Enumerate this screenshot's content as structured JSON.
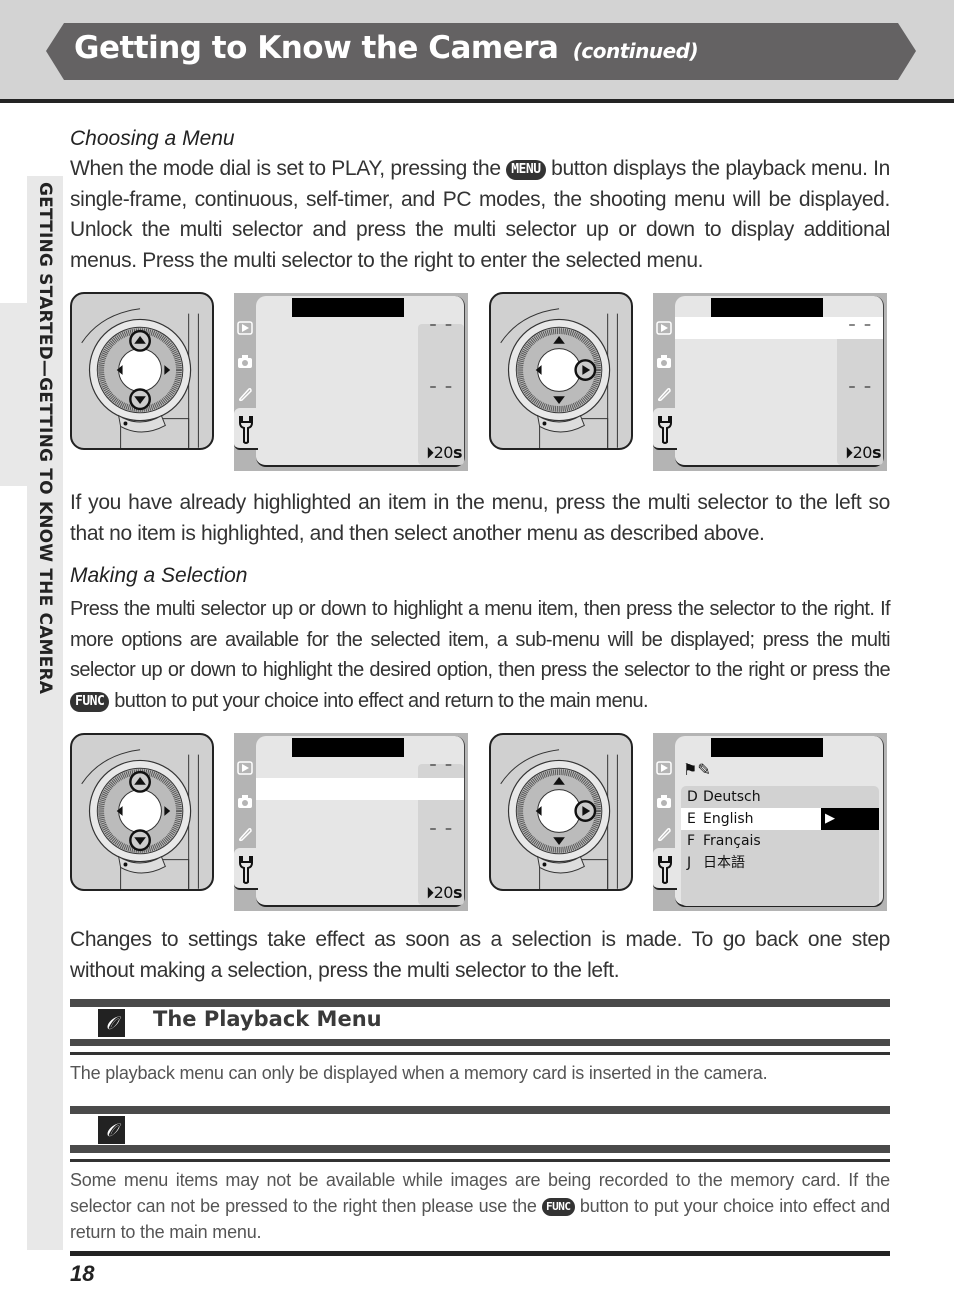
{
  "header": {
    "title": "Getting to Know the Camera",
    "subtitle": "(continued)"
  },
  "side_tab": {
    "label": "GETTING STARTED—GETTING TO KNOW THE CAMERA"
  },
  "sections": {
    "choosing": {
      "heading": "Choosing a Menu",
      "para1_before": "When the mode dial is set to PLAY, pressing the ",
      "para1_button": "MENU",
      "para1_after": " button displays the playback menu.  In single-frame, continuous, self-timer, and PC modes, the shooting menu will be displayed.  Unlock the multi selector and press the multi selector up or down to display additional menus.  Press the multi selector to the right to enter the selected menu.",
      "para2": "If you have already highlighted an item in the menu, press the multi selector to the left so that no item is highlighted, and then select another menu as described above."
    },
    "selection": {
      "heading": "Making a Selection",
      "para_before": "Press the multi selector up or down to highlight a menu item, then press the selector to the right.  If more options are available for the selected item, a sub-menu will be displayed; press the multi selector up or down to highlight the desired option, then press the selector to the right or press the ",
      "para_button": "FUNC",
      "para_after": " button to put your choice into effect and return to the main menu.",
      "para2": "Changes to settings take effect as soon as a selection is made.  To go back one step without making a selection, press the multi selector to the left."
    }
  },
  "illustrations": {
    "lcd_dash": "– –",
    "lcd_timer_value": "20",
    "lcd_timer_unit": "s",
    "lcd_tab_icons": [
      "playback-icon",
      "camera-icon",
      "pencil-icon",
      "wrench-icon"
    ],
    "language_menu": {
      "items": [
        {
          "code": "D",
          "label": "Deutsch",
          "selected": false
        },
        {
          "code": "E",
          "label": "English",
          "selected": true
        },
        {
          "code": "F",
          "label": "Français",
          "selected": false
        },
        {
          "code": "J",
          "label": "日本語",
          "selected": false
        }
      ],
      "arrow": "▶"
    }
  },
  "notes": [
    {
      "icon": "paperclip-icon",
      "title": "The Playback Menu",
      "text": "The playback menu can only be displayed when a memory card is inserted in the camera."
    },
    {
      "icon": "paperclip-icon",
      "title": "",
      "text_before": "Some menu items may not be available while images are being recorded to the memory card. If the selector can not be pressed to the right then please use the ",
      "text_button": "FUNC",
      "text_after": " button to put your choice into effect and return to the main menu."
    }
  ],
  "footer": {
    "page_number": "18"
  }
}
